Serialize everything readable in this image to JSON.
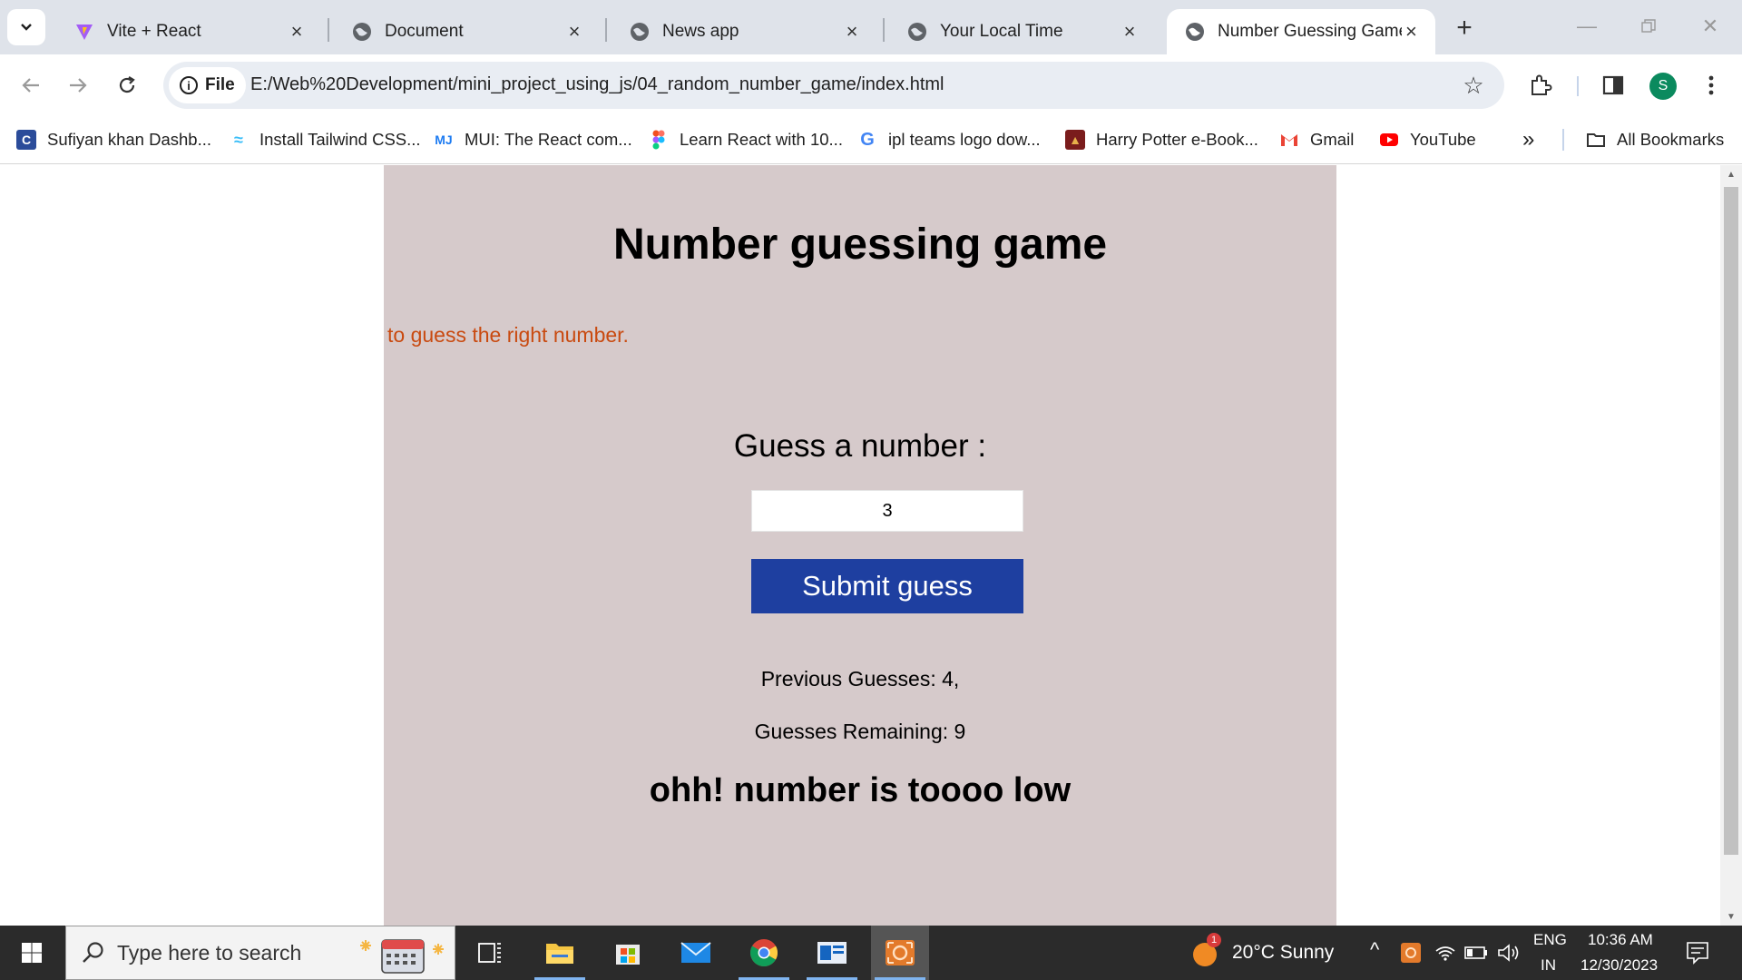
{
  "browser": {
    "tabs": [
      {
        "title": "Vite + React",
        "icon": "vite-icon",
        "active": false
      },
      {
        "title": "Document",
        "icon": "globe-icon",
        "active": false
      },
      {
        "title": "News app",
        "icon": "globe-icon",
        "active": false
      },
      {
        "title": "Your Local Time",
        "icon": "globe-icon",
        "active": false
      },
      {
        "title": "Number Guessing Game",
        "icon": "globe-icon",
        "active": true
      }
    ],
    "address": {
      "scheme_label": "File",
      "url": "E:/Web%20Development/mini_project_using_js/04_random_number_game/index.html"
    },
    "profile_initial": "S",
    "bookmarks": [
      {
        "label": "Sufiyan khan Dashb...",
        "icon": "c-logo-icon"
      },
      {
        "label": "Install Tailwind CSS...",
        "icon": "tailwind-icon"
      },
      {
        "label": "MUI: The React com...",
        "icon": "mui-icon"
      },
      {
        "label": "Learn React with 10...",
        "icon": "figma-icon"
      },
      {
        "label": "ipl teams logo dow...",
        "icon": "google-icon"
      },
      {
        "label": "Harry Potter e-Book...",
        "icon": "book-icon"
      },
      {
        "label": "Gmail",
        "icon": "gmail-icon"
      },
      {
        "label": "YouTube",
        "icon": "youtube-icon"
      }
    ],
    "all_bookmarks_label": "All Bookmarks"
  },
  "page": {
    "title": "Number guessing game",
    "subtitle": "to guess the right number.",
    "guess_label": "Guess a number :",
    "guess_value": "3",
    "submit_label": "Submit guess",
    "previous_guesses": "Previous Guesses: 4,",
    "guesses_remaining": "Guesses Remaining: 9",
    "result_message": "ohh! number is toooo low",
    "colors": {
      "panel_bg": "#d6cacb",
      "subtitle": "#c94a10",
      "button_bg": "#1e3fa0"
    }
  },
  "taskbar": {
    "search_placeholder": "Type here to search",
    "weather": "20°C  Sunny",
    "weather_badge": "1",
    "language_line1": "ENG",
    "language_line2": "IN",
    "time": "10:36 AM",
    "date": "12/30/2023"
  }
}
